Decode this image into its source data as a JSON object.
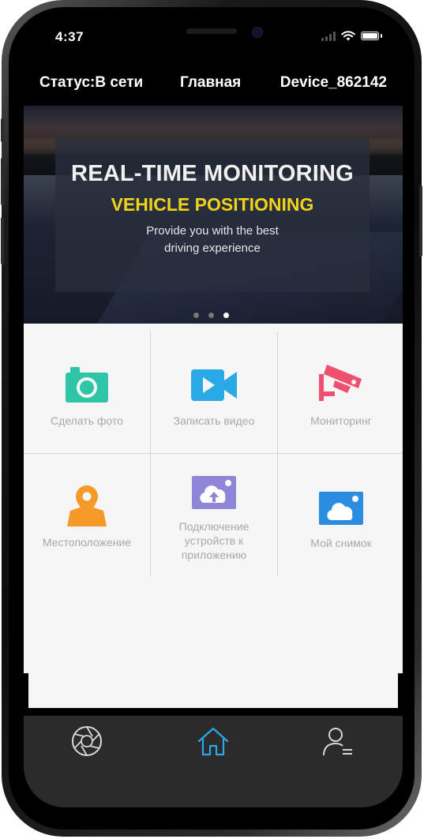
{
  "statusbar": {
    "time": "4:37"
  },
  "header": {
    "status": "Статус:В сети",
    "title": "Главная",
    "device": "Device_862142"
  },
  "banner": {
    "heading": "REAL-TIME MONITORING",
    "subheading": "VEHICLE POSITIONING",
    "line1": "Provide you with the best",
    "line2": "driving experience",
    "dots": 3,
    "active_dot": 3
  },
  "grid": {
    "items": [
      {
        "label": "Сделать фото",
        "icon": "camera-icon",
        "color": "#2fc5a7"
      },
      {
        "label": "Записать видео",
        "icon": "video-camera-icon",
        "color": "#29a9e6"
      },
      {
        "label": "Мониторинг",
        "icon": "cctv-icon",
        "color": "#f0506e"
      },
      {
        "label": "Местоположение",
        "icon": "map-pin-icon",
        "color": "#f59a28"
      },
      {
        "label_lines": [
          "Подключение",
          "устройств к",
          "приложению"
        ],
        "icon": "cloud-upload-icon",
        "color": "#8f86d8"
      },
      {
        "label": "Мой снимок",
        "icon": "cloud-photo-icon",
        "color": "#2a8de0"
      }
    ]
  },
  "tabbar": {
    "tabs": [
      {
        "name": "aperture-icon",
        "active": false
      },
      {
        "name": "home-icon",
        "active": true
      },
      {
        "name": "user-menu-icon",
        "active": false
      }
    ],
    "active_color": "#29a9e6",
    "inactive_color": "#d8d8d8"
  }
}
